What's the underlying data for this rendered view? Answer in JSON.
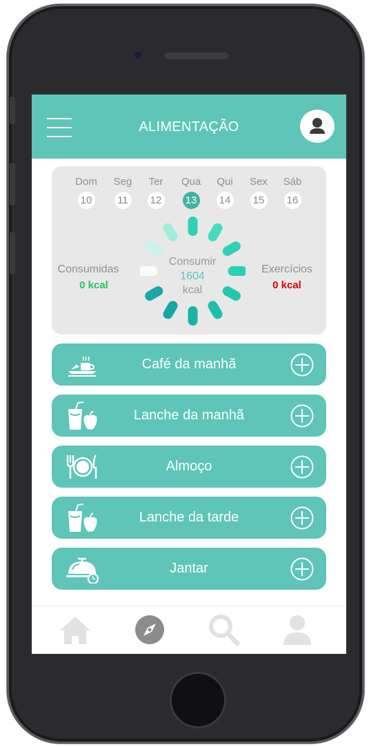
{
  "header": {
    "title": "ALIMENTAÇÃO",
    "color": "#5ec5b8",
    "menu_icon": "hamburger-menu-icon",
    "profile_icon": "user-avatar-icon"
  },
  "week": {
    "days": [
      {
        "name": "Dom",
        "num": "10"
      },
      {
        "name": "Seg",
        "num": "11"
      },
      {
        "name": "Ter",
        "num": "12"
      },
      {
        "name": "Qua",
        "num": "13",
        "selected": true
      },
      {
        "name": "Qui",
        "num": "14"
      },
      {
        "name": "Sex",
        "num": "15"
      },
      {
        "name": "Sáb",
        "num": "16"
      }
    ]
  },
  "summary": {
    "consumed_label": "Consumidas",
    "consumed_value": "0 kcal",
    "consumed_color": "#22c55e",
    "center_label": "Consumir",
    "center_value": "1604",
    "center_unit": "kcal",
    "exercise_label": "Exercícios",
    "exercise_value": "0 kcal",
    "exercise_color": "#e00000"
  },
  "meals": [
    {
      "label": "Café da manhã",
      "icon": "breakfast-tray-icon"
    },
    {
      "label": "Lanche da manhã",
      "icon": "drink-apple-icon"
    },
    {
      "label": "Almoço",
      "icon": "plate-cutlery-icon"
    },
    {
      "label": "Lanche da tarde",
      "icon": "drink-apple-icon"
    },
    {
      "label": "Jantar",
      "icon": "cloche-icon"
    }
  ],
  "tabbar": {
    "items": [
      "home-icon",
      "compass-icon",
      "search-icon",
      "profile-icon"
    ],
    "active": "compass-icon"
  }
}
